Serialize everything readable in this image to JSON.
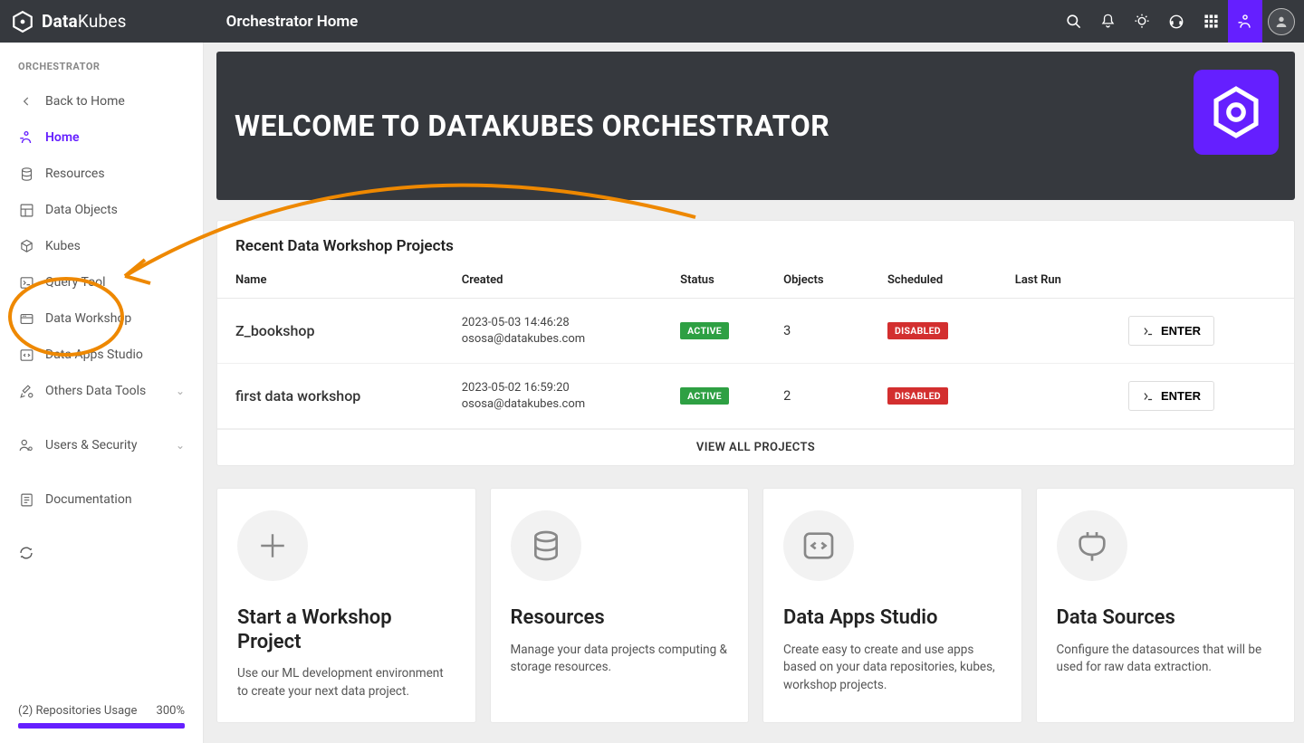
{
  "brand": {
    "name_a": "Data",
    "name_b": "Kubes"
  },
  "header_title": "Orchestrator Home",
  "sidebar": {
    "section_label": "ORCHESTRATOR",
    "items": [
      {
        "label": "Back to Home"
      },
      {
        "label": "Home"
      },
      {
        "label": "Resources"
      },
      {
        "label": "Data Objects"
      },
      {
        "label": "Kubes"
      },
      {
        "label": "Query Tool"
      },
      {
        "label": "Data Workshop"
      },
      {
        "label": "Data Apps Studio"
      },
      {
        "label": "Others Data Tools"
      },
      {
        "label": "Users & Security"
      },
      {
        "label": "Documentation"
      }
    ],
    "repo": {
      "label": "(2) Repositories Usage",
      "pct": "300%"
    }
  },
  "hero": {
    "title": "WELCOME TO DATAKUBES ORCHESTRATOR"
  },
  "recent": {
    "title": "Recent Data Workshop Projects",
    "columns": [
      "Name",
      "Created",
      "Status",
      "Objects",
      "Scheduled",
      "Last Run"
    ],
    "rows": [
      {
        "name": "Z_bookshop",
        "created_ts": "2023-05-03 14:46:28",
        "created_by": "ososa@datakubes.com",
        "status": "ACTIVE",
        "objects": "3",
        "scheduled": "DISABLED",
        "last_run": ""
      },
      {
        "name": "first data workshop",
        "created_ts": "2023-05-02 16:59:20",
        "created_by": "ososa@datakubes.com",
        "status": "ACTIVE",
        "objects": "2",
        "scheduled": "DISABLED",
        "last_run": ""
      }
    ],
    "enter_label": "ENTER",
    "view_all": "VIEW ALL PROJECTS"
  },
  "cards": [
    {
      "title": "Start a Workshop Project",
      "desc": "Use our ML development environment to create your next data project."
    },
    {
      "title": "Resources",
      "desc": "Manage your data projects computing & storage resources."
    },
    {
      "title": "Data Apps Studio",
      "desc": "Create easy to create and use apps based on your data repositories, kubes, workshop projects."
    },
    {
      "title": "Data Sources",
      "desc": "Configure the datasources that will be used for raw data extraction."
    }
  ]
}
